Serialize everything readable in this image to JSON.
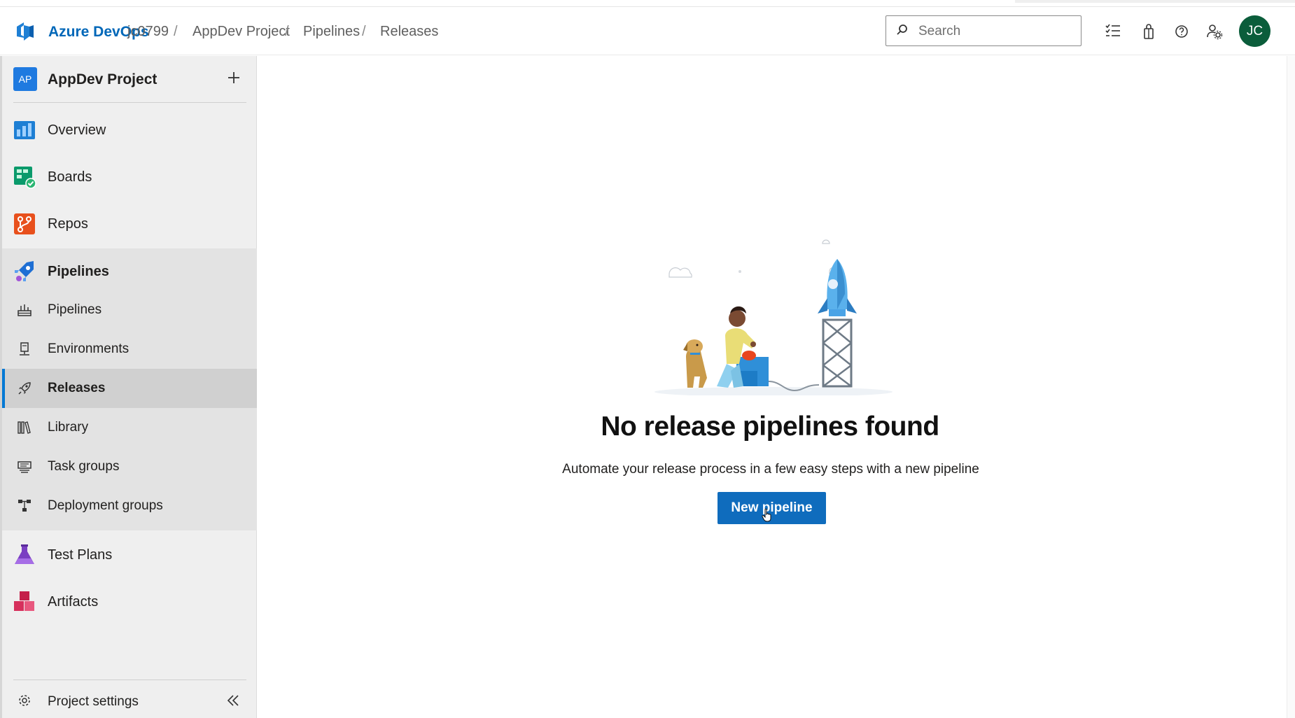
{
  "header": {
    "brand": "Azure DevOps",
    "breadcrumbs": [
      "jc0799",
      "AppDev Project",
      "Pipelines",
      "Releases"
    ],
    "search_placeholder": "Search",
    "avatar_initials": "JC",
    "icons": [
      "task-list-icon",
      "shopping-bag-icon",
      "help-icon",
      "user-settings-icon"
    ]
  },
  "sidebar": {
    "project_badge": "AP",
    "project_name": "AppDev Project",
    "items": [
      {
        "label": "Overview",
        "icon": "overview-icon"
      },
      {
        "label": "Boards",
        "icon": "boards-icon"
      },
      {
        "label": "Repos",
        "icon": "repos-icon"
      },
      {
        "label": "Pipelines",
        "icon": "pipelines-icon"
      },
      {
        "label": "Test Plans",
        "icon": "test-plans-icon"
      },
      {
        "label": "Artifacts",
        "icon": "artifacts-icon"
      }
    ],
    "pipeline_sub_items": [
      {
        "label": "Pipelines",
        "icon": "pipeline-sub-icon"
      },
      {
        "label": "Environments",
        "icon": "environments-icon"
      },
      {
        "label": "Releases",
        "icon": "releases-icon",
        "selected": true
      },
      {
        "label": "Library",
        "icon": "library-icon"
      },
      {
        "label": "Task groups",
        "icon": "task-groups-icon"
      },
      {
        "label": "Deployment groups",
        "icon": "deployment-groups-icon"
      }
    ],
    "settings_label": "Project settings"
  },
  "main": {
    "empty_title": "No release pipelines found",
    "empty_subtitle": "Automate your release process in a few easy steps with a new pipeline",
    "new_pipeline_label": "New pipeline"
  },
  "colors": {
    "brand": "#0067b8",
    "primary_button": "#0f6cbd",
    "avatar": "#0b5d3b",
    "selected_accent": "#0078d4"
  }
}
